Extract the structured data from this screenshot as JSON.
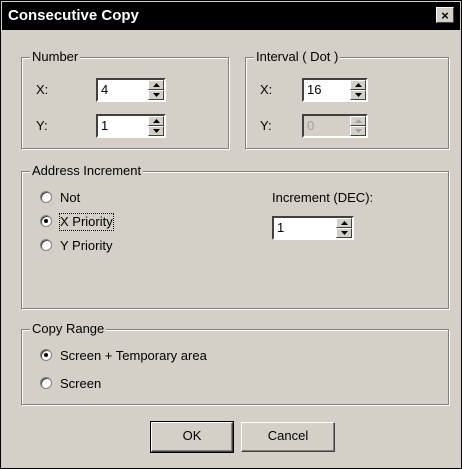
{
  "window": {
    "title": "Consecutive Copy",
    "close_label": "×"
  },
  "number": {
    "legend": "Number",
    "x_label": "X:",
    "x_value": "4",
    "y_label": "Y:",
    "y_value": "1"
  },
  "interval": {
    "legend": "Interval ( Dot )",
    "x_label": "X:",
    "x_value": "16",
    "y_label": "Y:",
    "y_value": "0"
  },
  "address_increment": {
    "legend": "Address Increment",
    "options": [
      "Not",
      "X Priority",
      "Y Priority"
    ],
    "selected": "X Priority",
    "increment_label": "Increment (DEC):",
    "increment_value": "1"
  },
  "copy_range": {
    "legend": "Copy Range",
    "options": [
      "Screen + Temporary area",
      "Screen"
    ],
    "selected": "Screen + Temporary area"
  },
  "buttons": {
    "ok": "OK",
    "cancel": "Cancel"
  }
}
